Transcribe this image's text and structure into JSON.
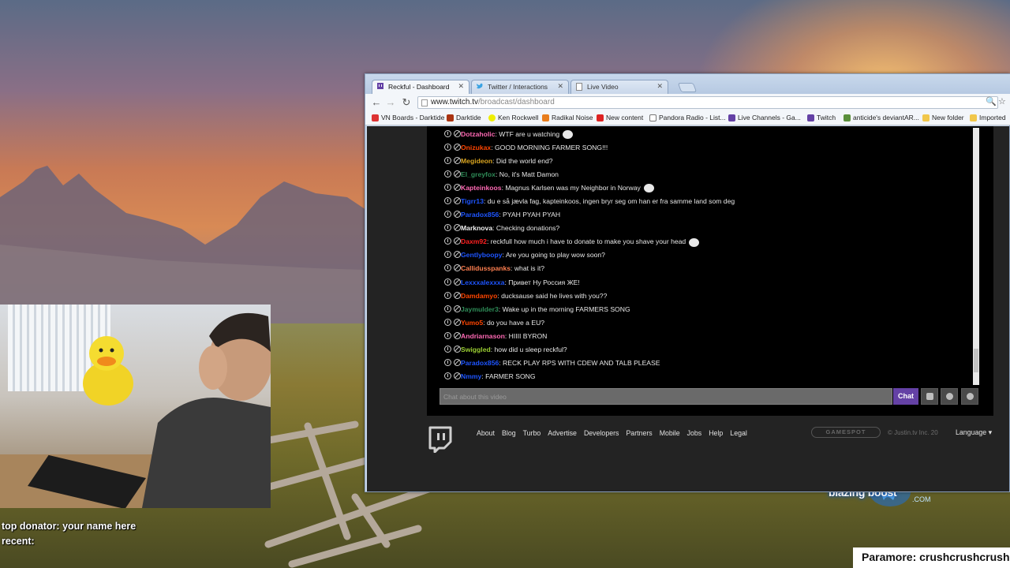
{
  "stream_overlay": {
    "top_donator": "top donator: your name here",
    "recent": "recent:",
    "now_playing": "Paramore: crushcrushcrush",
    "sponsor_logo": "blazing boost",
    "sponsor_logo_suffix": ".COM"
  },
  "browser": {
    "tabs": [
      {
        "label": "Reckful - Dashboard",
        "icon": "twitch-icon",
        "active": true
      },
      {
        "label": "Twitter / Interactions",
        "icon": "twitter-icon",
        "active": false
      },
      {
        "label": "Live Video",
        "icon": "page-icon",
        "active": false
      }
    ],
    "url_host": "www.twitch.tv",
    "url_path": "/broadcast/dashboard",
    "bookmarks": [
      "VN Boards - Darktide",
      "Darktide",
      "Ken Rockwell",
      "Radikal Noise",
      "New content",
      "Pandora Radio - List...",
      "Live Channels - Ga...",
      "Twitch",
      "anticide's deviantAR...",
      "New folder",
      "Imported"
    ]
  },
  "chat": {
    "messages": [
      {
        "user": "Dotzaholic",
        "color": "#ff69b4",
        "text": "WTF are u watching",
        "emote": true
      },
      {
        "user": "Onizukax",
        "color": "#ff4500",
        "text": "GOOD MORNING FARMER SONG!!!",
        "emote": false
      },
      {
        "user": "Megideon",
        "color": "#daa520",
        "text": "Did the world end?",
        "emote": false
      },
      {
        "user": "El_greyfox",
        "color": "#2e8b57",
        "text": "No, it's Matt Damon",
        "emote": false
      },
      {
        "user": "Kapteinkoos",
        "color": "#ff69b4",
        "text": "Magnus Karlsen was my Neighbor in Norway",
        "emote": true
      },
      {
        "user": "Tigrr13",
        "color": "#1e55ff",
        "text": "du e så jævla fag, kapteinkoos, ingen bryr seg om han er fra samme land som deg",
        "emote": false
      },
      {
        "user": "Paradox856",
        "color": "#1e55ff",
        "text": "PYAH PYAH PYAH",
        "emote": false
      },
      {
        "user": "Marknova",
        "color": "#f0f0f0",
        "text": "Checking donations?",
        "emote": false
      },
      {
        "user": "Daxm92",
        "color": "#ff2020",
        "text": "reckfull how much i have to donate to make you shave your head",
        "emote": true
      },
      {
        "user": "Gentlyboopy",
        "color": "#1e55ff",
        "text": "Are you going to play wow soon?",
        "emote": false
      },
      {
        "user": "Callidusspanks",
        "color": "#ff7f50",
        "text": "what is it?",
        "emote": false
      },
      {
        "user": "Lexxxalexxxa",
        "color": "#1e55ff",
        "text": "Привет Ну Россия ЖЕ!",
        "emote": false
      },
      {
        "user": "Damdamyo",
        "color": "#ff4500",
        "text": "ducksause said he lives with you??",
        "emote": false
      },
      {
        "user": "Jaymulder3",
        "color": "#2e8b57",
        "text": "Wake up in the morning FARMERS SONG",
        "emote": false
      },
      {
        "user": "Yumo5",
        "color": "#ff4500",
        "text": "do you have a EU?",
        "emote": false
      },
      {
        "user": "Andriarnason",
        "color": "#ff69b4",
        "text": "HIIII BYRON",
        "emote": false
      },
      {
        "user": "Swiggled",
        "color": "#9acd32",
        "text": "how did u sleep reckful?",
        "emote": false
      },
      {
        "user": "Paradox856",
        "color": "#1e55ff",
        "text": "RECK PLAY RPS WITH CDEW AND TALB PLEASE",
        "emote": false
      },
      {
        "user": "Nmmy",
        "color": "#1e55ff",
        "text": "FARMER SONG",
        "emote": false
      }
    ],
    "input_placeholder": "Chat about this video",
    "chat_button": "Chat"
  },
  "footer": {
    "links": [
      "About",
      "Blog",
      "Turbo",
      "Advertise",
      "Developers",
      "Partners",
      "Mobile",
      "Jobs",
      "Help",
      "Legal"
    ],
    "gamespot": "GAMESPOT",
    "copyright": "© Justin.tv Inc. 20",
    "language": "Language"
  },
  "colors": {
    "twitch_purple": "#6441a5",
    "chat_background": "#000000",
    "page_background": "#232323"
  }
}
